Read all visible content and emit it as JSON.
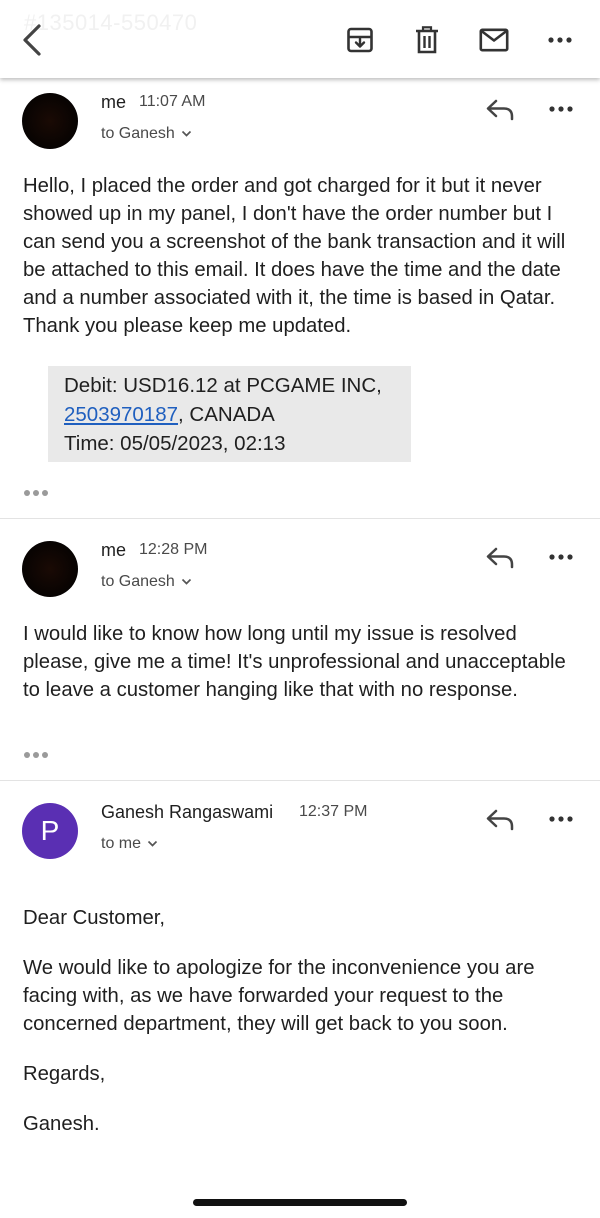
{
  "watermark": "#135014-550470",
  "toolbar": {
    "back_icon": "chevron-left-icon",
    "archive_icon": "archive-icon",
    "delete_icon": "trash-icon",
    "mark_unread_icon": "mail-icon",
    "more_icon": "more-horizontal-icon"
  },
  "messages": [
    {
      "sender": "me",
      "time": "11:07 AM",
      "recipient": "to Ganesh",
      "body": [
        "Hello, I placed the order and got charged for it but it never showed up in my panel, I don't have the order number but I can send you a screenshot of the bank transaction and it will be attached to this email. It does have the time and the date and a number associated with it, the time is based in Qatar. Thank you please keep me updated."
      ],
      "quote": {
        "line1": "Debit: USD16.12 at PCGAME INC,",
        "link": "2503970187",
        "line2_rest": ", CANADA",
        "line3": "Time: 05/05/2023, 02:13"
      }
    },
    {
      "sender": "me",
      "time": "12:28 PM",
      "recipient": "to Ganesh",
      "body": [
        "I would like to know how long until my issue is resolved please, give me a time! It's unprofessional and unacceptable to leave a customer hanging like that with no response."
      ]
    },
    {
      "sender": "Ganesh Rangaswami",
      "avatar_letter": "P",
      "avatar_color": "#5a2fb3",
      "time": "12:37 PM",
      "recipient": "to me",
      "body": [
        "Dear Customer,",
        "We would like to apologize for the inconvenience you are facing with, as we have forwarded your request to the concerned department, they will get back to you soon.",
        "Regards,",
        "Ganesh."
      ]
    }
  ],
  "colors": {
    "link": "#1f5fbf",
    "quote_bg": "#e9e9e9",
    "avatar_purple": "#5a2fb3"
  }
}
